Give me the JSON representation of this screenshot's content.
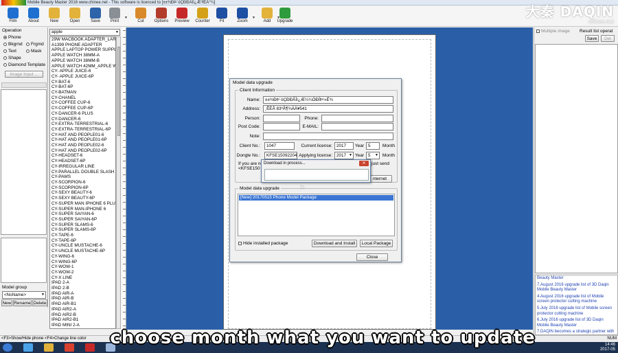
{
  "window": {
    "title": "Mobile Beauty Master 2016 www.chinee.net - This software is licenced to [±±¾ÐÞ´óÇÐÐÂÌì¿Æ³ÌÊÀ°¼]",
    "watermark_cn": "大秦",
    "watermark_en": "DAQIN",
    "watermark_url": "chinee.net"
  },
  "toolbar": [
    {
      "label": "Film",
      "icon": "film-icon",
      "color": "#1f6fd1"
    },
    {
      "label": "About",
      "icon": "info-icon",
      "color": "#1f6fd1"
    },
    {
      "label": "New",
      "icon": "new-folder-icon",
      "color": "#e2b23a"
    },
    {
      "label": "Open",
      "icon": "open-folder-icon",
      "color": "#e2b23a"
    },
    {
      "label": "Save",
      "icon": "save-icon",
      "color": "#2d63a8"
    },
    {
      "label": "Print",
      "icon": "printer-icon",
      "color": "#8a8f96"
    },
    {
      "label": "Cut",
      "icon": "cut-icon",
      "color": "#d88a2a"
    },
    {
      "label": "Options",
      "icon": "tools-icon",
      "color": "#b33b2a"
    },
    {
      "label": "Preview",
      "icon": "preview-icon",
      "color": "#c62828"
    },
    {
      "label": "Counter",
      "icon": "counter-icon",
      "color": "#d4a017"
    },
    {
      "label": "Fit",
      "icon": "fit-icon",
      "color": "#1d4fa3"
    },
    {
      "label": "Zoom",
      "icon": "zoom-icon",
      "color": "#1d4fa3"
    },
    {
      "label": "Add",
      "icon": "add-icon",
      "color": "#e2b23a"
    },
    {
      "label": "Upgrade",
      "icon": "upgrade-icon",
      "color": "#2e9b3c"
    }
  ],
  "operation": {
    "group_label": "Operation",
    "options": [
      "Phone",
      "Bkgrnd",
      "Frgmd",
      "Text",
      "Mask",
      "Shape",
      "Diamond Template"
    ],
    "selected": "Phone",
    "image_input_label": "Image Input ...",
    "model_group_label": "Model group",
    "model_group_value": "<NoName>",
    "new_label": "New",
    "rename_label": "Rename",
    "delete_label": "Delete"
  },
  "model_list": {
    "search_value": "apple",
    "items": [
      "29W MACBOOK ADAPTER_LARGE",
      "A1399 PHONE ADAPTER",
      "APPLE LAPTOP POWER SUPPLY",
      "APPLE WATCH 38MM-A",
      "APPLE WATCH 38MM-B",
      "APPLE WATCH 42MM_APPLE WATCH",
      "CY- APPLE JUICE-6",
      "CY- APPLE JUICE-6P",
      "CY-BAT-6",
      "CY-BAT-6P",
      "CY-BATMAN",
      "CY-CHANEL",
      "CY-COFFEE CUP-6",
      "CY-COFFEE CUP-6P",
      "CY-DANCER-6 PLUS",
      "CY-DANCER-6",
      "CY-EXTRA-TERRESTRIAL-6",
      "CY-EXTRA-TERRESTRIAL-6P",
      "CY-HAT AND PEOPLE01-6",
      "CY-HAT AND PEOPLE01-6P",
      "CY-HAT AND PEOPLE02-6",
      "CY-HAT AND PEOPLE02-6P",
      "CY-HEADSET-6",
      "CY-HEADSET-6P",
      "CY-IRREGULAR LINE",
      "CY-PARALLEL DOUBLE SLASH",
      "CY-PAWS",
      "CY-SCORPION-6",
      "CY-SCORPION-6P",
      "CY-SEXY BEAUTY-6",
      "CY-SEXY BEAUTY-6P",
      "CY-SUPER MAN IPHONE 6 PLUS",
      "CY-SUPER MAN-IPHONE 6",
      "CY-SUPER SAIYAN-6",
      "CY-SUPER SAIYAN-6P",
      "CY-SUPER SLAMS-6",
      "CY-SUPER SLAMS-6P",
      "CY-TAPE-6",
      "CY-TAPE-6P",
      "CY-UNCLE MUSTACHE-6",
      "CY-UNCLE MUSTACHE-6P",
      "CY-WING-6",
      "CY-WING-6P",
      "CY-WOW-1",
      "CY-WOW-2",
      "CY-X LINE",
      "IPAD 2-A",
      "IPAD 2-B",
      "IPAD AIR-A",
      "IPAD AIR-B",
      "IPAD AIR-B1",
      "IPAD AIR2-A",
      "IPAD AIR2-B",
      "IPAD AIR2-B1",
      "IPAD MINI 2-A"
    ]
  },
  "dialog": {
    "title": "Model data upgrade",
    "client_info_label": "Client Information",
    "name_label": "Name:",
    "name_value": "±±¾ÐÞ´óÇÐÐÂÌì¿Æ¼¼ÓÐÏÞ¹«Ë¾",
    "address_label": "Address:",
    "address_value": "¸ÊÈÅ 83ºÅ¶¾ÁÄ¥541",
    "person_label": "Person:",
    "phone_label": "Phone:",
    "postcode_label": "Post Code:",
    "email_label": "E-MAIL:",
    "note_label": "Note:",
    "client_no_label": "Client No.:",
    "client_no_value": "1047",
    "current_license_label": "Current license:",
    "current_year": "2017",
    "year_label": "Year",
    "current_month": "5",
    "month_label": "Month",
    "dongle_no_label": "Dongle No.:",
    "dongle_no_value": "KFSE15092204",
    "applying_license_label": "Applying license:",
    "applying_year": "2017",
    "applying_month": "5",
    "notice_text_1": "If you are no",
    "notice_text_2": "just send",
    "notice_text_3": "<KFSE150",
    "internet_button": "nternet",
    "model_upgrade_label": "Model data upgrade",
    "package_item": "[New] 20170515 Phone Model Package",
    "hide_installed_label": "Hide installed package",
    "download_install_label": "Download and Install",
    "local_package_label": "Local Package",
    "close_label": "Close"
  },
  "popup": {
    "title": "Download in process...",
    "close_symbol": "✕"
  },
  "right_panel": {
    "multiple_image_label": "Multiple image",
    "result_list_label": "Result list operat",
    "save_label": "Save",
    "del_label": "Del",
    "news": [
      "Beauty Master",
      "7.August 2016 upgrade list of 3D Daqin Mobile Beauty Master",
      "4.August 2016 upgrade list of Mobile screen protector cutting machine",
      "5.July 2016 upgrade list of Mobile screen protector cutting machine",
      "6.July 2016 upgrade list of 3D Daqin Mobile Beauty Master",
      "7.DAQIN becomes a strategic partner with"
    ]
  },
  "status_bar": {
    "text": "<F3>Show/Hide phone <F4>Change line color",
    "num_label": "NUM"
  },
  "taskbar": {
    "time": "14:46",
    "date": "2017-05"
  },
  "subtitle": "choose month what you want to update"
}
